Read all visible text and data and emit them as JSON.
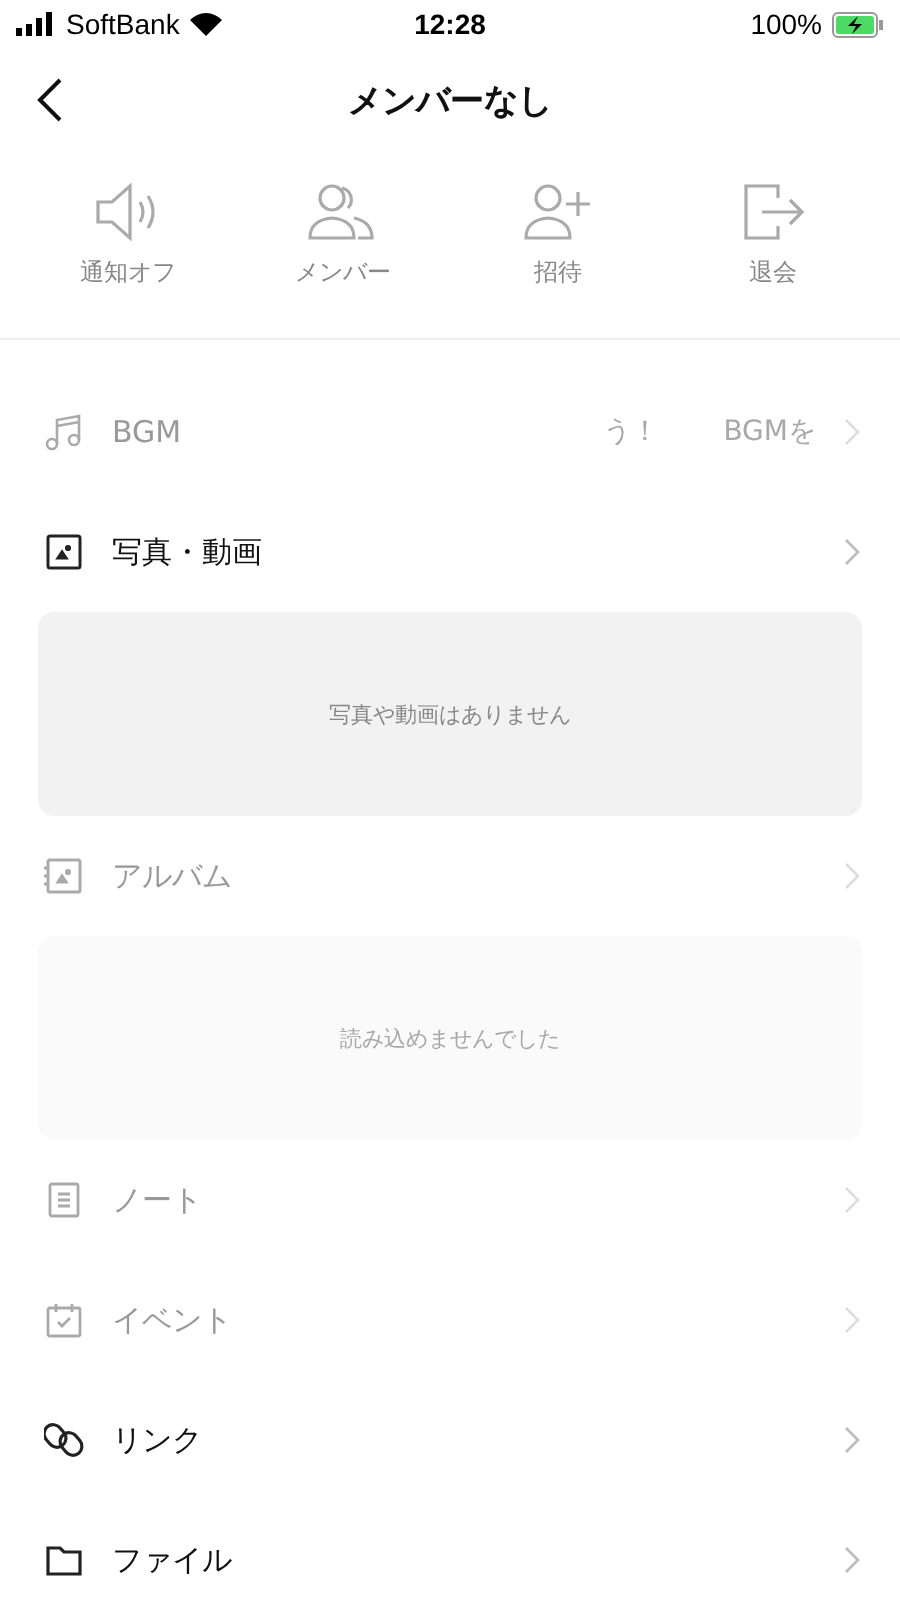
{
  "status_bar": {
    "carrier": "SoftBank",
    "time": "12:28",
    "battery": "100%"
  },
  "header": {
    "title": "メンバーなし"
  },
  "actions": [
    {
      "kind": "speaker",
      "label": "通知オフ"
    },
    {
      "kind": "members",
      "label": "メンバー"
    },
    {
      "kind": "invite",
      "label": "招待"
    },
    {
      "kind": "leave",
      "label": "退会"
    }
  ],
  "sections": [
    {
      "kind": "music",
      "label": "BGM",
      "disabled": true,
      "extras": [
        "う！",
        "BGMを"
      ]
    },
    {
      "kind": "photo",
      "label": "写真・動画",
      "disabled": false,
      "panel": {
        "message": "写真や動画はありません",
        "disabled": false
      }
    },
    {
      "kind": "album",
      "label": "アルバム",
      "disabled": true,
      "panel": {
        "message": "読み込めませんでした",
        "disabled": true
      }
    },
    {
      "kind": "note",
      "label": "ノート",
      "disabled": true
    },
    {
      "kind": "event",
      "label": "イベント",
      "disabled": true
    },
    {
      "kind": "link",
      "label": "リンク",
      "disabled": false
    },
    {
      "kind": "folder",
      "label": "ファイル",
      "disabled": false
    }
  ]
}
